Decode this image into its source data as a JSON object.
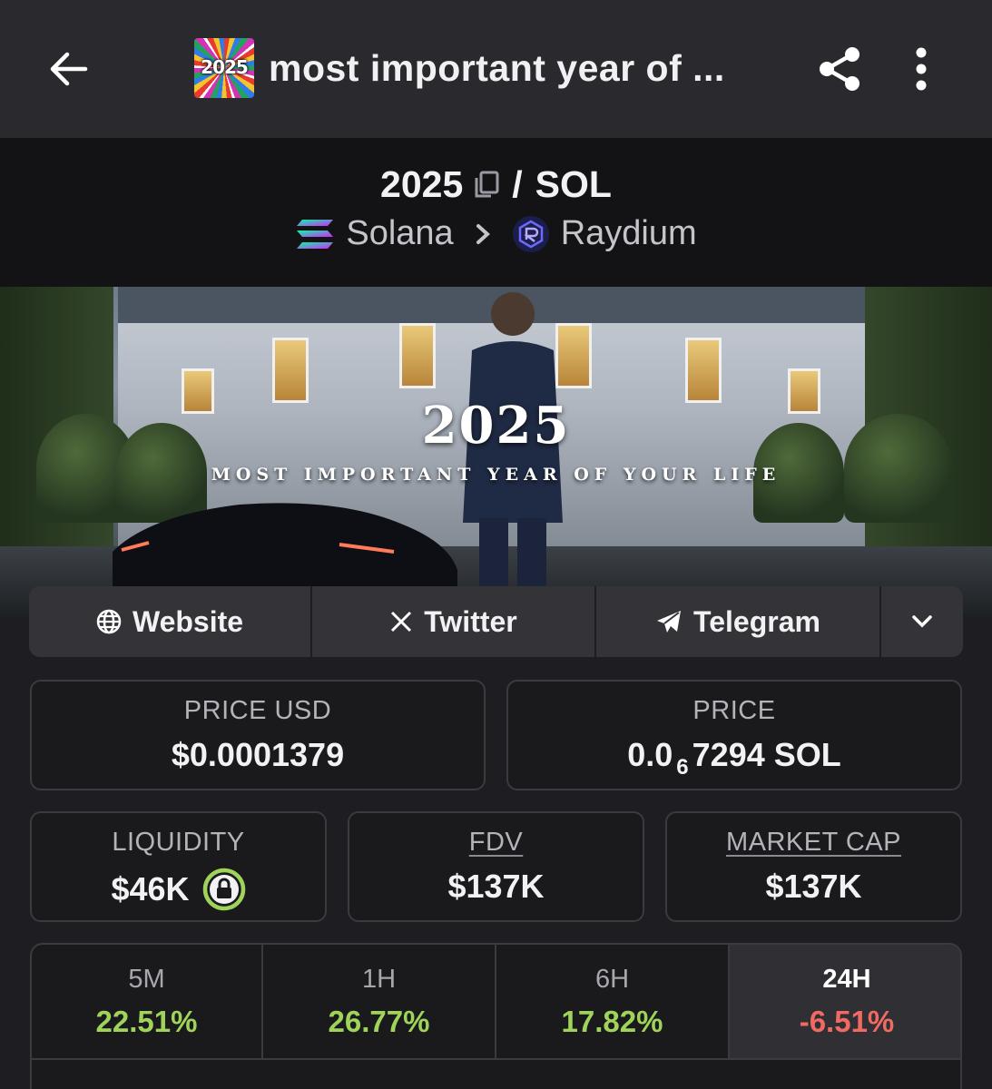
{
  "appbar": {
    "title": "most important year of ...",
    "token_thumb_text": "2025"
  },
  "pair": {
    "base": "2025",
    "separator": "/",
    "quote": "SOL",
    "chain": "Solana",
    "dex": "Raydium"
  },
  "banner": {
    "headline": "2025",
    "subline": "MOST IMPORTANT YEAR OF YOUR LIFE"
  },
  "links": {
    "website": "Website",
    "twitter": "Twitter",
    "telegram": "Telegram"
  },
  "stats": {
    "price_usd_label": "PRICE USD",
    "price_usd_value": "$0.0001379",
    "price_label": "PRICE",
    "price_prefix": "0.0",
    "price_zero_count": "6",
    "price_digits": "7294 SOL",
    "liquidity_label": "LIQUIDITY",
    "liquidity_value": "$46K",
    "fdv_label": "FDV",
    "fdv_value": "$137K",
    "mcap_label": "MARKET CAP",
    "mcap_value": "$137K"
  },
  "timeframes": [
    {
      "label": "5M",
      "value": "22.51%",
      "color": "#9fd35a"
    },
    {
      "label": "1H",
      "value": "26.77%",
      "color": "#9fd35a"
    },
    {
      "label": "6H",
      "value": "17.82%",
      "color": "#9fd35a"
    },
    {
      "label": "24H",
      "value": "-6.51%",
      "color": "#f06a63",
      "active": true
    }
  ],
  "colors": {
    "positive": "#9fd35a",
    "negative": "#f06a63",
    "lock_ring": "#9fd35a"
  },
  "icons": [
    "back-arrow-icon",
    "share-icon",
    "more-vertical-icon",
    "copy-icon",
    "solana-icon",
    "chevron-right-icon",
    "raydium-icon",
    "globe-icon",
    "x-logo-icon",
    "telegram-icon",
    "chevron-down-icon",
    "lock-icon"
  ]
}
